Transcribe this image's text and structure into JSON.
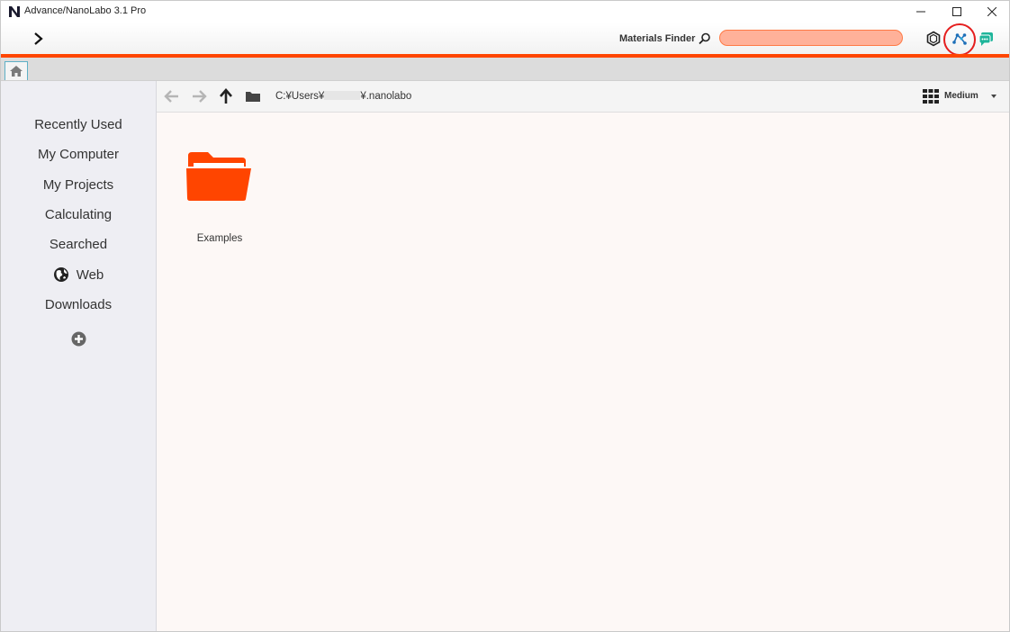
{
  "window": {
    "title": "Advance/NanoLabo 3.1 Pro",
    "controls": [
      "minimize",
      "maximize",
      "close"
    ]
  },
  "toolbar": {
    "materials_finder_label": "Materials Finder",
    "search_value": "",
    "accent_color": "#ff4500",
    "icons": [
      "expand-chevron-icon",
      "hexagon-icon",
      "materials-network-icon",
      "chat-icon"
    ]
  },
  "tabs": [
    {
      "name": "home",
      "icon": "home-icon",
      "active": true
    }
  ],
  "sidebar": {
    "items": [
      {
        "label": "Recently Used"
      },
      {
        "label": "My Computer"
      },
      {
        "label": "My Projects"
      },
      {
        "label": "Calculating"
      },
      {
        "label": "Searched"
      },
      {
        "label": "Web",
        "icon": "globe-icon"
      },
      {
        "label": "Downloads"
      }
    ],
    "add_icon": "plus-circle-icon"
  },
  "pathbar": {
    "path_prefix": "C:¥Users¥",
    "path_suffix": "¥.nanolabo",
    "view_mode": "Medium"
  },
  "content": {
    "items": [
      {
        "label": "Examples",
        "type": "folder",
        "color": "#ff4500"
      }
    ]
  }
}
